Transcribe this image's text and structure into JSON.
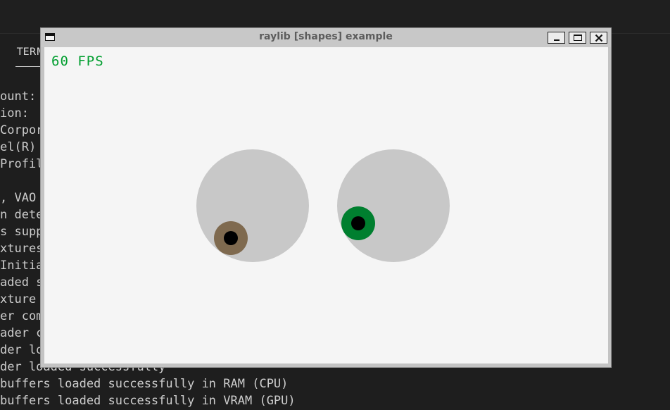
{
  "background": {
    "terminal_tab": "TERM",
    "terminal_lines": [
      "ount:",
      "ion:",
      "Corpor",
      "el(R)",
      "Profil",
      "",
      ", VAO",
      "n dete",
      "s supp",
      "xtures",
      "Initia",
      "aded s",
      "xture",
      "er com",
      "ader c",
      "der lo",
      "der loaded successfully",
      "buffers loaded successfully in RAM (CPU)",
      "buffers loaded successfully in VRAM (GPU)"
    ]
  },
  "window": {
    "title": "raylib [shapes] example",
    "icons": {
      "app": "window-icon",
      "minimize": "minimize-icon",
      "maximize": "maximize-icon",
      "close": "close-icon"
    }
  },
  "canvas": {
    "fps_text": "60 FPS",
    "colors": {
      "background": "#f5f5f5",
      "sclera": "#c8c8c8",
      "left_iris": "#7f6a4f",
      "right_iris": "#007f2f",
      "pupil": "#000000",
      "fps": "#009e2f"
    }
  }
}
